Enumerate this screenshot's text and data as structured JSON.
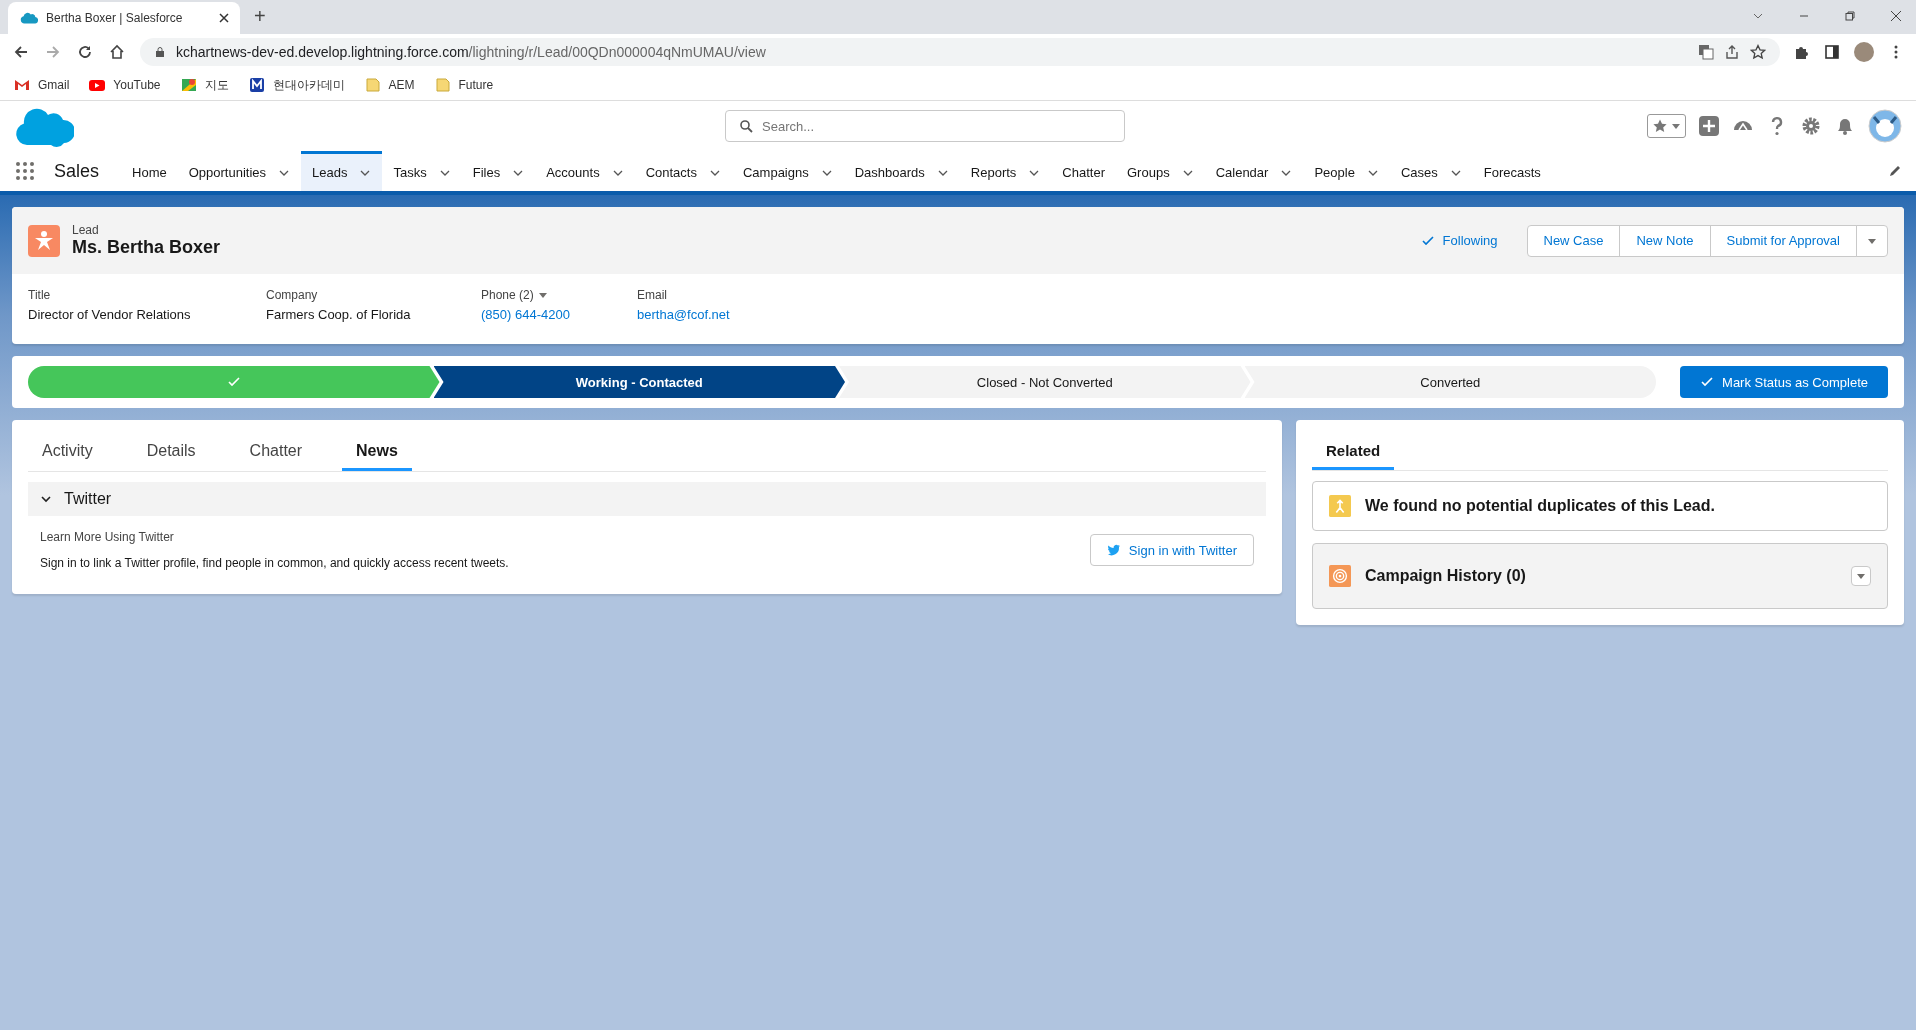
{
  "browser": {
    "tab_title": "Bertha Boxer | Salesforce",
    "new_tab": "+",
    "url_host": "kchartnews-dev-ed.develop.lightning.force.com",
    "url_path": "/lightning/r/Lead/00QDn000004qNmUMAU/view",
    "bookmarks": [
      {
        "label": "Gmail",
        "kind": "gmail"
      },
      {
        "label": "YouTube",
        "kind": "youtube"
      },
      {
        "label": "지도",
        "kind": "maps"
      },
      {
        "label": "현대아카데미",
        "kind": "m"
      },
      {
        "label": "AEM",
        "kind": "folder"
      },
      {
        "label": "Future",
        "kind": "folder"
      }
    ]
  },
  "header": {
    "search_placeholder": "Search..."
  },
  "nav": {
    "app_name": "Sales",
    "items": [
      {
        "label": "Home",
        "dropdown": false,
        "selected": false
      },
      {
        "label": "Opportunities",
        "dropdown": true,
        "selected": false
      },
      {
        "label": "Leads",
        "dropdown": true,
        "selected": true
      },
      {
        "label": "Tasks",
        "dropdown": true,
        "selected": false
      },
      {
        "label": "Files",
        "dropdown": true,
        "selected": false
      },
      {
        "label": "Accounts",
        "dropdown": true,
        "selected": false
      },
      {
        "label": "Contacts",
        "dropdown": true,
        "selected": false
      },
      {
        "label": "Campaigns",
        "dropdown": true,
        "selected": false
      },
      {
        "label": "Dashboards",
        "dropdown": true,
        "selected": false
      },
      {
        "label": "Reports",
        "dropdown": true,
        "selected": false
      },
      {
        "label": "Chatter",
        "dropdown": false,
        "selected": false
      },
      {
        "label": "Groups",
        "dropdown": true,
        "selected": false
      },
      {
        "label": "Calendar",
        "dropdown": true,
        "selected": false
      },
      {
        "label": "People",
        "dropdown": true,
        "selected": false
      },
      {
        "label": "Cases",
        "dropdown": true,
        "selected": false
      },
      {
        "label": "Forecasts",
        "dropdown": false,
        "selected": false
      }
    ]
  },
  "record": {
    "type": "Lead",
    "name": "Ms. Bertha Boxer",
    "following": "Following",
    "actions": [
      "New Case",
      "New Note",
      "Submit for Approval"
    ],
    "fields": [
      {
        "label": "Title",
        "value": "Director of Vendor Relations",
        "kind": "text"
      },
      {
        "label": "Company",
        "value": "Farmers Coop. of Florida",
        "kind": "text"
      },
      {
        "label": "Phone (2)",
        "value": "(850) 644-4200",
        "kind": "phone"
      },
      {
        "label": "Email",
        "value": "bertha@fcof.net",
        "kind": "link"
      }
    ]
  },
  "path": {
    "stages": [
      {
        "kind": "complete"
      },
      {
        "label": "Working - Contacted",
        "kind": "current"
      },
      {
        "label": "Closed - Not Converted",
        "kind": "incomplete"
      },
      {
        "label": "Converted",
        "kind": "incomplete"
      }
    ],
    "button": "Mark Status as Complete"
  },
  "main": {
    "tabs": [
      {
        "label": "Activity",
        "selected": false
      },
      {
        "label": "Details",
        "selected": false
      },
      {
        "label": "Chatter",
        "selected": false
      },
      {
        "label": "News",
        "selected": true
      }
    ],
    "section": {
      "title": "Twitter",
      "expanded": true,
      "heading": "Learn More Using Twitter",
      "text": "Sign in to link a Twitter profile, find people in common, and quickly access recent tweets.",
      "button": "Sign in with Twitter"
    }
  },
  "related": {
    "tabs": [
      {
        "label": "Related",
        "selected": true
      }
    ],
    "duplicates": "We found no potential duplicates of this Lead.",
    "campaign_history": "Campaign History (0)"
  }
}
